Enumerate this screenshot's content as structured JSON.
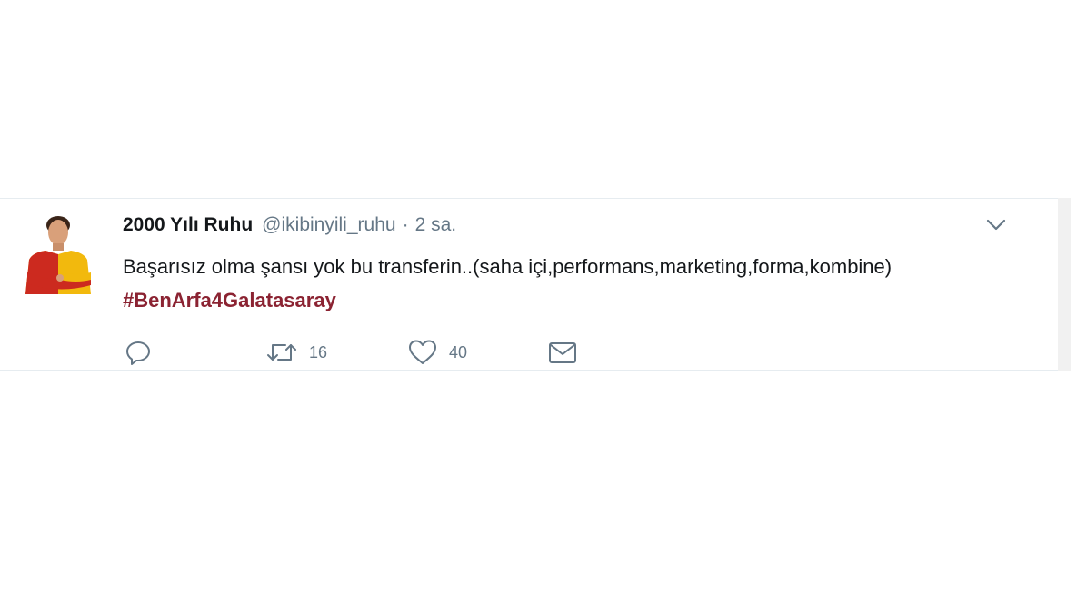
{
  "tweet": {
    "display_name": "2000 Yılı Ruhu",
    "handle": "@ikibinyili_ruhu",
    "separator": "·",
    "time": "2 sa.",
    "text": "Başarısız olma şansı yok bu transferin..(saha içi,performans,marketing,forma,kombine) ",
    "hashtag": "#BenArfa4Galatasaray",
    "avatar": "avatar-player-red-yellow-kit"
  },
  "actions": {
    "reply": {
      "icon": "reply-icon"
    },
    "retweet": {
      "icon": "retweet-icon",
      "count": "16"
    },
    "like": {
      "icon": "heart-icon",
      "count": "40"
    },
    "dm": {
      "icon": "envelope-icon"
    }
  },
  "menu": {
    "icon": "chevron-down-icon"
  },
  "colors": {
    "hashtag": "#8b2332",
    "text": "#14171a",
    "muted": "#657786",
    "border": "#e6ecf0"
  }
}
